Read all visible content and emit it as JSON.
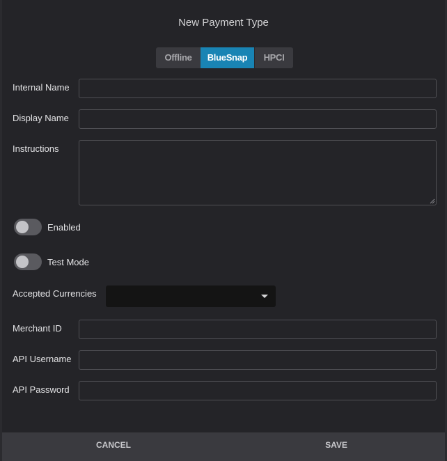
{
  "dialog": {
    "title": "New Payment Type"
  },
  "tabs": [
    {
      "label": "Offline",
      "active": false
    },
    {
      "label": "BlueSnap",
      "active": true
    },
    {
      "label": "HPCI",
      "active": false
    }
  ],
  "form": {
    "internal_name": {
      "label": "Internal Name",
      "value": ""
    },
    "display_name": {
      "label": "Display Name",
      "value": ""
    },
    "instructions": {
      "label": "Instructions",
      "value": ""
    },
    "enabled": {
      "label": "Enabled",
      "on": false
    },
    "test_mode": {
      "label": "Test Mode",
      "on": false
    },
    "accepted_currencies": {
      "label": "Accepted Currencies",
      "value": ""
    },
    "merchant_id": {
      "label": "Merchant ID",
      "value": ""
    },
    "api_username": {
      "label": "API Username",
      "value": ""
    },
    "api_password": {
      "label": "API Password",
      "value": ""
    }
  },
  "footer": {
    "cancel_label": "CANCEL",
    "save_label": "SAVE"
  },
  "colors": {
    "accent": "#1984b4",
    "background": "#242428",
    "footer": "#3a3a3f"
  }
}
